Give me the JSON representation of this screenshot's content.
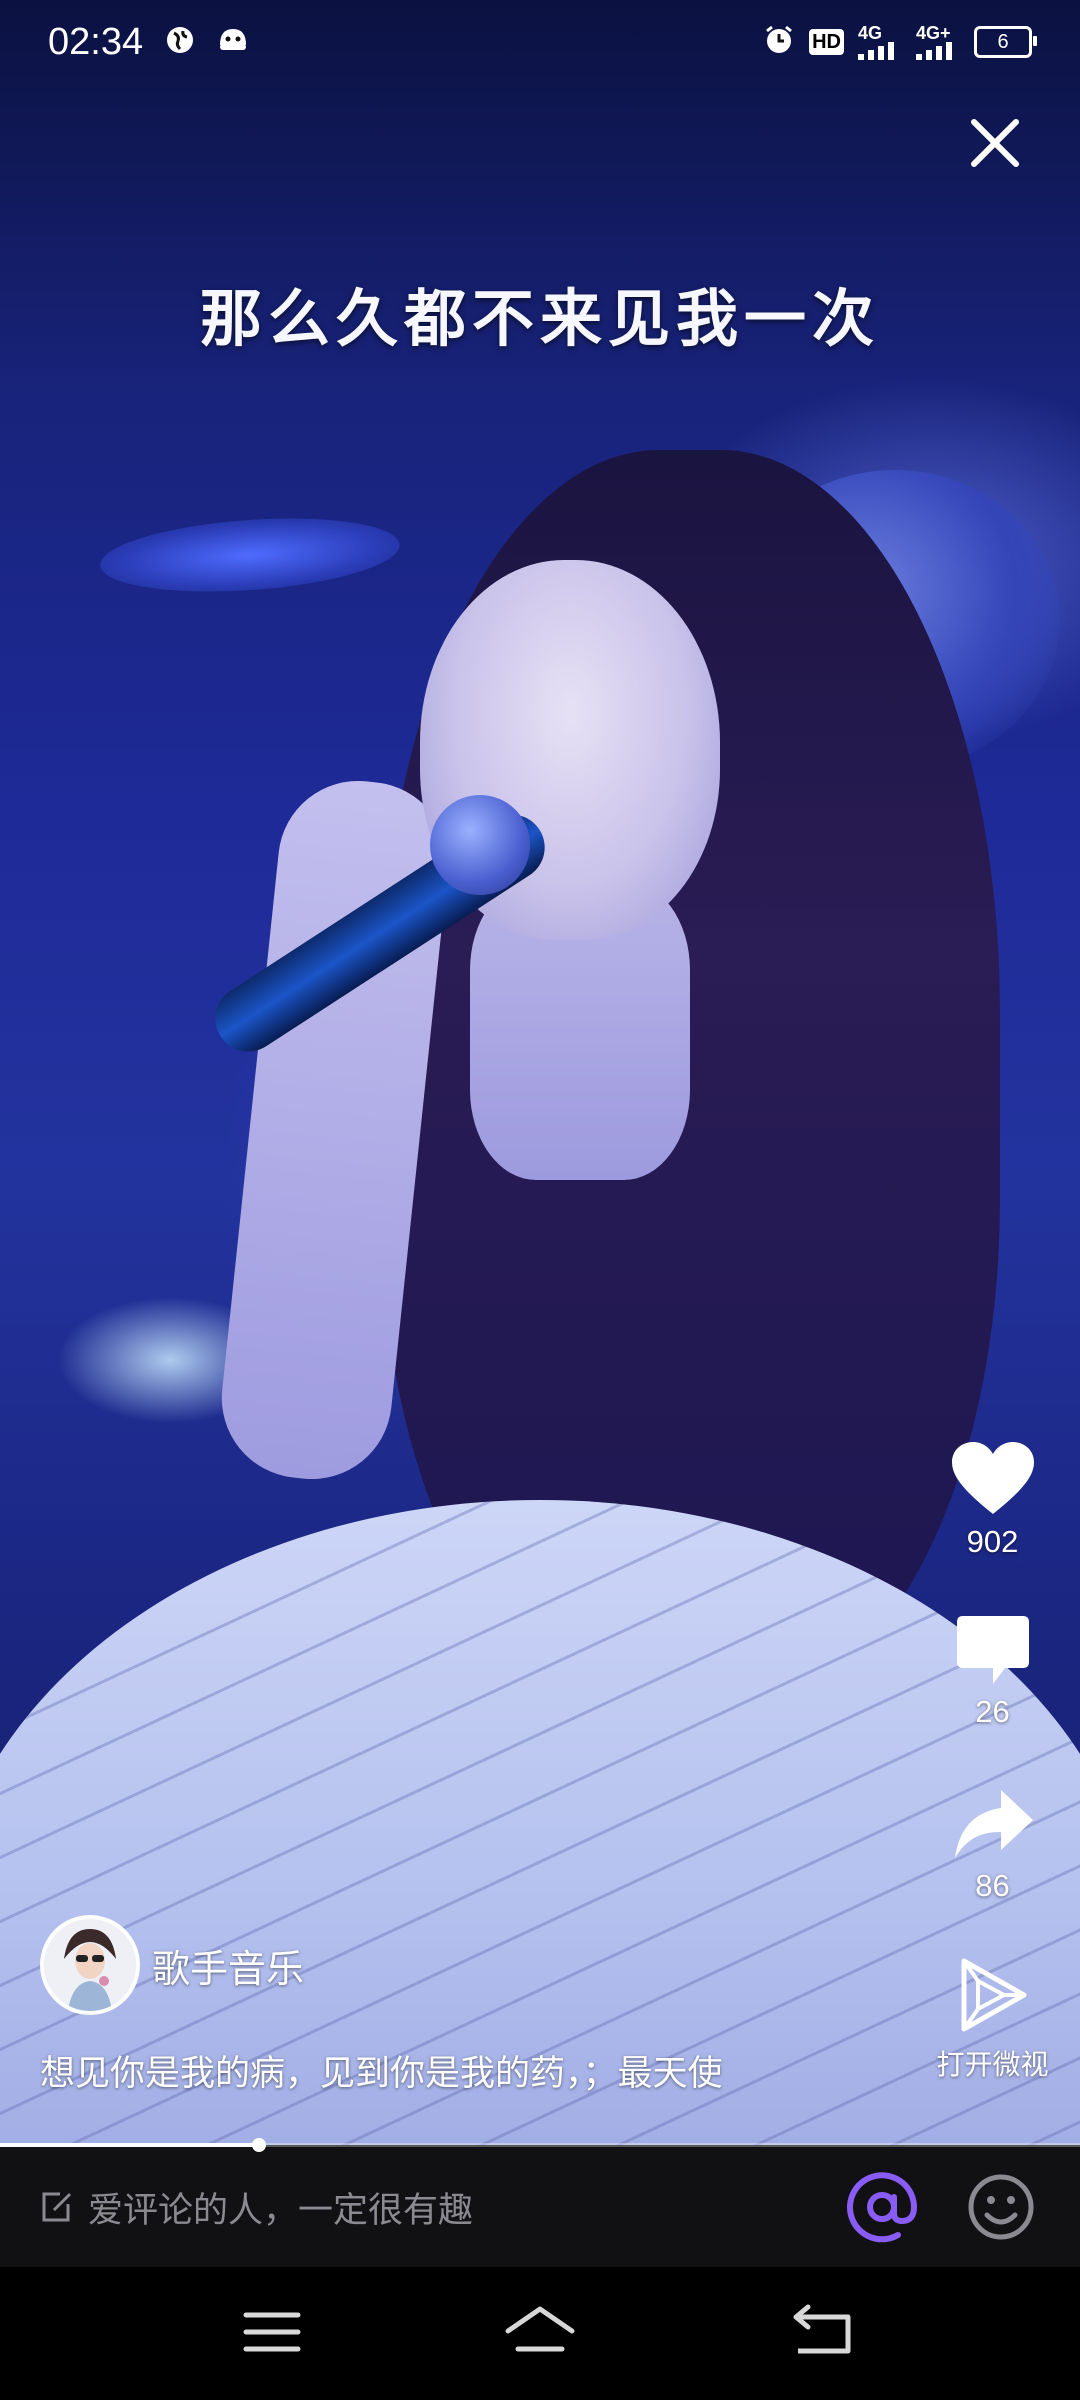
{
  "status_bar": {
    "time": "02:34",
    "hd_label": "HD",
    "network_1": "4G",
    "network_2": "4G+",
    "battery": "6"
  },
  "video": {
    "subtitle": "那么久都不来见我一次",
    "progress_fraction": 0.24
  },
  "actions": {
    "like_count": "902",
    "comment_count": "26",
    "share_count": "86",
    "open_app_label": "打开微视"
  },
  "author": {
    "name": "歌手音乐"
  },
  "caption": "想见你是我的病，见到你是我的药，；最天使",
  "comment_bar": {
    "placeholder": "爱评论的人，一定很有趣"
  },
  "colors": {
    "mention_accent": "#8a5cf6",
    "background": "#000000"
  },
  "icons": {
    "close": "close-icon",
    "like": "heart-icon",
    "comment": "comment-bubble-icon",
    "share": "share-arrow-icon",
    "open_app": "play-triangle-icon",
    "mention": "at-sign-icon",
    "emoji": "smiley-icon",
    "nav_menu": "menu-icon",
    "nav_home": "home-icon",
    "nav_back": "back-icon"
  }
}
